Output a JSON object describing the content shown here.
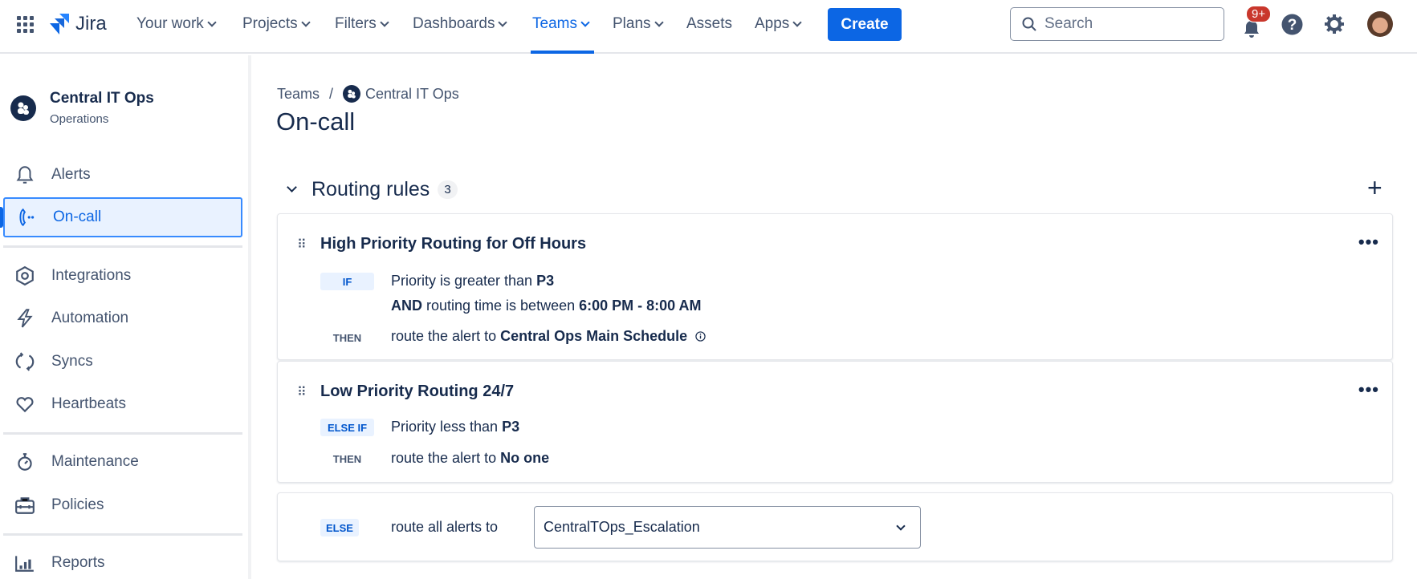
{
  "topbar": {
    "logo_text": "Jira",
    "nav": [
      {
        "label": "Your work",
        "dropdown": true
      },
      {
        "label": "Projects",
        "dropdown": true
      },
      {
        "label": "Filters",
        "dropdown": true
      },
      {
        "label": "Dashboards",
        "dropdown": true
      },
      {
        "label": "Teams",
        "dropdown": true,
        "active": true
      },
      {
        "label": "Plans",
        "dropdown": true
      },
      {
        "label": "Assets",
        "dropdown": false
      },
      {
        "label": "Apps",
        "dropdown": true
      }
    ],
    "create_label": "Create",
    "search_placeholder": "Search",
    "notification_badge": "9+",
    "accent": "#0c66e4"
  },
  "sidebar": {
    "team_name": "Central IT Ops",
    "team_type": "Operations",
    "items": [
      {
        "label": "Alerts",
        "icon": "bell-icon"
      },
      {
        "label": "On-call",
        "icon": "phone-icon",
        "selected": true
      },
      {
        "label": "Integrations",
        "icon": "hexagon-icon"
      },
      {
        "label": "Automation",
        "icon": "lightning-icon"
      },
      {
        "label": "Syncs",
        "icon": "sync-icon"
      },
      {
        "label": "Heartbeats",
        "icon": "heart-icon"
      },
      {
        "label": "Maintenance",
        "icon": "stopwatch-icon"
      },
      {
        "label": "Policies",
        "icon": "toolbox-icon"
      },
      {
        "label": "Reports",
        "icon": "bar-chart-icon"
      }
    ]
  },
  "main": {
    "breadcrumb": {
      "root": "Teams",
      "separator": "/",
      "current": "Central IT Ops"
    },
    "title": "On-call",
    "section": {
      "title": "Routing rules",
      "count": "3"
    },
    "rules": [
      {
        "title": "High Priority Routing for Off Hours",
        "condition_label": "IF",
        "condition_1_prefix": "Priority is greater than ",
        "condition_1_value": "P3",
        "condition_2_and": "AND",
        "condition_2_text": " routing time is between ",
        "condition_2_value": "6:00 PM - 8:00 AM",
        "then_label": "THEN",
        "then_prefix": "route the alert to ",
        "then_value": "Central Ops Main Schedule"
      },
      {
        "title": "Low Priority Routing 24/7",
        "condition_label": "ELSE IF",
        "condition_1_prefix": "Priority less than ",
        "condition_1_value": "P3",
        "then_label": "THEN",
        "then_prefix": "route the alert to ",
        "then_value": "No one"
      }
    ],
    "else_rule": {
      "label": "ELSE",
      "text": "route all alerts to",
      "selected": "CentralTOps_Escalation"
    }
  }
}
